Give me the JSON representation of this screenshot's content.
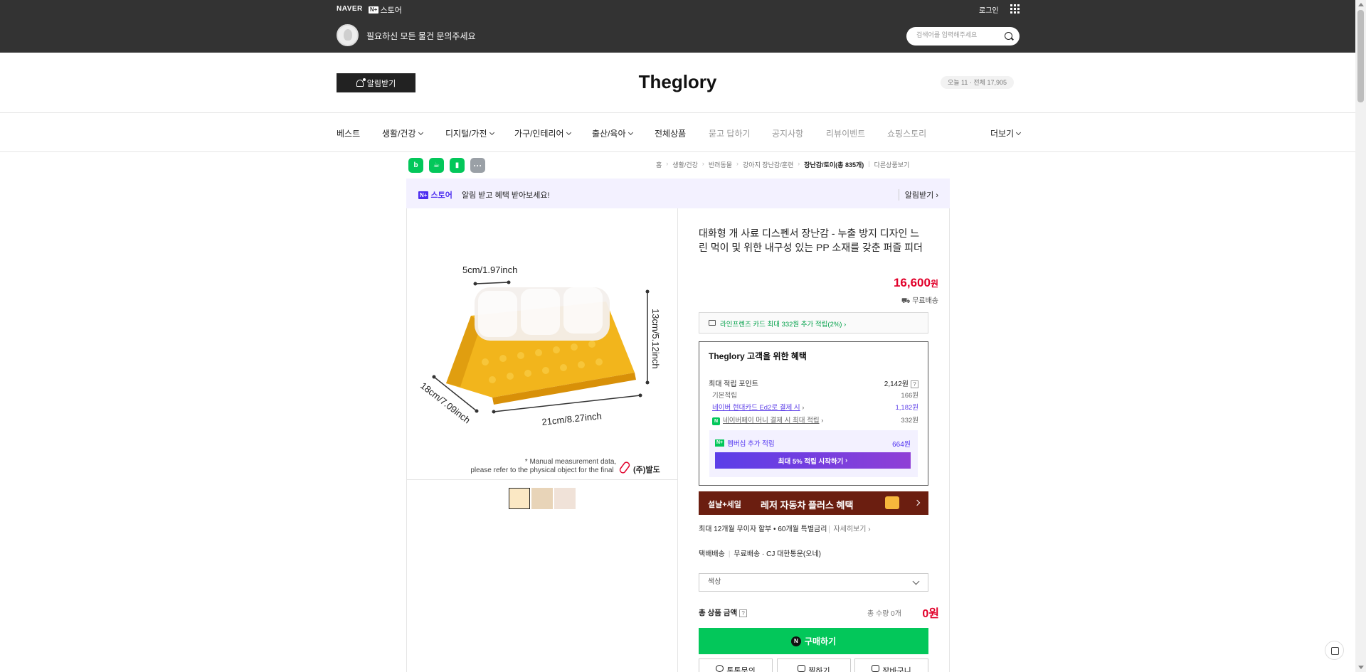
{
  "gnb": {
    "naver": "NAVER",
    "store_badge": "N+",
    "store_label": "스토어",
    "login": "로그인",
    "greeting": "필요하신 모든 물건 문의주세요",
    "search_placeholder": "검색어를 입력해주세요"
  },
  "header": {
    "notify": "알림받기",
    "store_name": "Theglory",
    "visitors": "오늘 11 · 전체 17,905"
  },
  "nav": {
    "items": [
      {
        "label": "베스트",
        "dropdown": false,
        "muted": false
      },
      {
        "label": "생활/건강",
        "dropdown": true,
        "muted": false
      },
      {
        "label": "디지털/가전",
        "dropdown": true,
        "muted": false
      },
      {
        "label": "가구/인테리어",
        "dropdown": true,
        "muted": false
      },
      {
        "label": "출산/육아",
        "dropdown": true,
        "muted": false
      },
      {
        "label": "전체상품",
        "dropdown": false,
        "muted": false
      },
      {
        "label": "묻고 답하기",
        "dropdown": false,
        "muted": true
      },
      {
        "label": "공지사항",
        "dropdown": false,
        "muted": true
      },
      {
        "label": "리뷰이벤트",
        "dropdown": false,
        "muted": true
      },
      {
        "label": "쇼핑스토리",
        "dropdown": false,
        "muted": true
      }
    ],
    "more": "더보기"
  },
  "share_icons": [
    "blog-icon",
    "talk-icon",
    "bookmark-icon",
    "more-icon"
  ],
  "breadcrumb": {
    "items": [
      "홈",
      "생활/건강",
      "반려동물",
      "강아지 장난감/훈련",
      "장난감/토이(총 835개)",
      "다른상품보기"
    ]
  },
  "promo": {
    "badge": "N+",
    "store": "스토어",
    "message": "알림 받고 혜택 받아보세요!",
    "action": "알림받기"
  },
  "product": {
    "image_labels": {
      "width_top": "5cm/1.97inch",
      "height": "13cm/5.12inch",
      "depth": "18cm/7.09inch",
      "width": "21cm/8.27inch",
      "note_line1": "* Manual measurement data,",
      "note_line2": "please refer to the physical object for the final",
      "watermark": "(주)발도"
    },
    "title": "대화형 개 사료 디스펜서 장난감 - 누출 방지 디자인 느린 먹이 및 위한 내구성 있는 PP 소재를 갖춘 퍼즐 피더",
    "price": "16,600",
    "price_unit": "원",
    "shipping": "무료배송",
    "card_offer": "라인프렌즈 카드 최대 332원 추가 적립(2%)"
  },
  "benefit": {
    "title": "Theglory 고객을 위한 혜택",
    "max_points_label": "최대 적립 포인트",
    "max_points_value": "2,142원",
    "basic_label": "기본적립",
    "basic_value": "166원",
    "hyundai_label": "네이버 현대카드 Ed2로 결제 시",
    "hyundai_value": "1,182원",
    "naverpay_label": "네이버페이 머니 결제 시 최대 적립",
    "naverpay_value": "332원",
    "membership_label": "멤버십 추가 적립",
    "membership_value": "664원",
    "membership_button": "최대 5% 적립 시작하기"
  },
  "banner": {
    "sale": "설날+세일",
    "text": "레저 자동차 플러스 혜택"
  },
  "installment": {
    "text": "최대 12개월 무이자 할부 • 60개월 특별금리",
    "more": "자세히보기"
  },
  "delivery": {
    "type": "택배배송",
    "detail": "무료배송 · CJ 대한통운(오네)"
  },
  "option": {
    "placeholder": "색상"
  },
  "total": {
    "label": "총 상품 금액",
    "qty": "총 수량 0개",
    "amount": "0원"
  },
  "actions": {
    "buy": "구매하기",
    "talk": "톡톡문의",
    "wish": "찜하기",
    "cart": "장바구니"
  }
}
